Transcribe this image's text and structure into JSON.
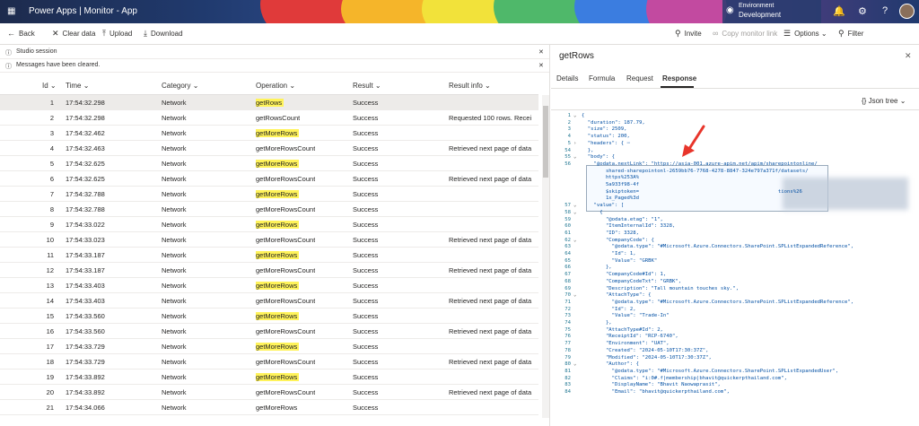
{
  "topbar": {
    "app_title": "Power Apps | Monitor - App",
    "env_label": "Environment",
    "env_value": "Development"
  },
  "toolbar": {
    "back": "Back",
    "clear": "Clear data",
    "upload": "Upload",
    "download": "Download",
    "invite": "Invite",
    "copy_link": "Copy monitor link",
    "options": "Options",
    "filter": "Filter"
  },
  "notices": {
    "studio": "Studio session",
    "cleared": "Messages have been cleared."
  },
  "table": {
    "columns": [
      "Id",
      "Time",
      "Category",
      "Operation",
      "Result",
      "Result info"
    ],
    "rows": [
      {
        "id": "1",
        "time": "17:54:32.298",
        "category": "Network",
        "operation": "getRows",
        "result": "Success",
        "info": "",
        "hl": true
      },
      {
        "id": "2",
        "time": "17:54:32.298",
        "category": "Network",
        "operation": "getRowsCount",
        "result": "Success",
        "info": "Requested 100 rows. Recei",
        "hl": false
      },
      {
        "id": "3",
        "time": "17:54:32.462",
        "category": "Network",
        "operation": "getMoreRows",
        "result": "Success",
        "info": "",
        "hl": true
      },
      {
        "id": "4",
        "time": "17:54:32.463",
        "category": "Network",
        "operation": "getMoreRowsCount",
        "result": "Success",
        "info": "Retrieved next page of data",
        "hl": false
      },
      {
        "id": "5",
        "time": "17:54:32.625",
        "category": "Network",
        "operation": "getMoreRows",
        "result": "Success",
        "info": "",
        "hl": true
      },
      {
        "id": "6",
        "time": "17:54:32.625",
        "category": "Network",
        "operation": "getMoreRowsCount",
        "result": "Success",
        "info": "Retrieved next page of data",
        "hl": false
      },
      {
        "id": "7",
        "time": "17:54:32.788",
        "category": "Network",
        "operation": "getMoreRows",
        "result": "Success",
        "info": "",
        "hl": true
      },
      {
        "id": "8",
        "time": "17:54:32.788",
        "category": "Network",
        "operation": "getMoreRowsCount",
        "result": "Success",
        "info": "",
        "hl": false
      },
      {
        "id": "9",
        "time": "17:54:33.022",
        "category": "Network",
        "operation": "getMoreRows",
        "result": "Success",
        "info": "",
        "hl": true
      },
      {
        "id": "10",
        "time": "17:54:33.023",
        "category": "Network",
        "operation": "getMoreRowsCount",
        "result": "Success",
        "info": "Retrieved next page of data",
        "hl": false
      },
      {
        "id": "11",
        "time": "17:54:33.187",
        "category": "Network",
        "operation": "getMoreRows",
        "result": "Success",
        "info": "",
        "hl": true
      },
      {
        "id": "12",
        "time": "17:54:33.187",
        "category": "Network",
        "operation": "getMoreRowsCount",
        "result": "Success",
        "info": "Retrieved next page of data",
        "hl": false
      },
      {
        "id": "13",
        "time": "17:54:33.403",
        "category": "Network",
        "operation": "getMoreRows",
        "result": "Success",
        "info": "",
        "hl": true
      },
      {
        "id": "14",
        "time": "17:54:33.403",
        "category": "Network",
        "operation": "getMoreRowsCount",
        "result": "Success",
        "info": "Retrieved next page of data",
        "hl": false
      },
      {
        "id": "15",
        "time": "17:54:33.560",
        "category": "Network",
        "operation": "getMoreRows",
        "result": "Success",
        "info": "",
        "hl": true
      },
      {
        "id": "16",
        "time": "17:54:33.560",
        "category": "Network",
        "operation": "getMoreRowsCount",
        "result": "Success",
        "info": "Retrieved next page of data",
        "hl": false
      },
      {
        "id": "17",
        "time": "17:54:33.729",
        "category": "Network",
        "operation": "getMoreRows",
        "result": "Success",
        "info": "",
        "hl": true
      },
      {
        "id": "18",
        "time": "17:54:33.729",
        "category": "Network",
        "operation": "getMoreRowsCount",
        "result": "Success",
        "info": "Retrieved next page of data",
        "hl": false
      },
      {
        "id": "19",
        "time": "17:54:33.892",
        "category": "Network",
        "operation": "getMoreRows",
        "result": "Success",
        "info": "",
        "hl": true
      },
      {
        "id": "20",
        "time": "17:54:33.892",
        "category": "Network",
        "operation": "getMoreRowsCount",
        "result": "Success",
        "info": "Retrieved next page of data",
        "hl": false
      },
      {
        "id": "21",
        "time": "17:54:34.066",
        "category": "Network",
        "operation": "getMoreRows",
        "result": "Success",
        "info": "",
        "hl": false
      }
    ]
  },
  "detail": {
    "title": "getRows",
    "tabs": [
      "Details",
      "Formula",
      "Request",
      "Response"
    ],
    "view_mode": "Json tree",
    "code_lines": [
      {
        "n": "1",
        "f": "⌄",
        "t": "{"
      },
      {
        "n": "2",
        "f": "",
        "t": "  \"duration\": 187.79,"
      },
      {
        "n": "3",
        "f": "",
        "t": "  \"size\": 2509,"
      },
      {
        "n": "4",
        "f": "",
        "t": "  \"status\": 200,"
      },
      {
        "n": "5",
        "f": "›",
        "t": "  \"headers\": { ⋯"
      },
      {
        "n": "54",
        "f": "",
        "t": "  },"
      },
      {
        "n": "55",
        "f": "⌄",
        "t": "  \"body\": {"
      },
      {
        "n": "56",
        "f": "",
        "t": "    \"@odata.nextLink\": \"https://asia-001.azure-apim.net/apim/sharepointonline/"
      },
      {
        "n": "",
        "f": "",
        "t": "        shared-sharepointonl-2659bb76-7768-4278-8847-324e797a371f/datasets/"
      },
      {
        "n": "",
        "f": "",
        "t": "        https%253A%"
      },
      {
        "n": "",
        "f": "",
        "t": "        5a933f98-4f"
      },
      {
        "n": "",
        "f": "",
        "t": "        $skiptoken=                                              tions%26"
      },
      {
        "n": "",
        "f": "",
        "t": "        1x_Paged%3d"
      },
      {
        "n": "57",
        "f": "⌄",
        "t": "    \"value\": ["
      },
      {
        "n": "58",
        "f": "⌄",
        "t": "      {"
      },
      {
        "n": "59",
        "f": "",
        "t": "        \"@odata.etag\": \"1\","
      },
      {
        "n": "60",
        "f": "",
        "t": "        \"ItemInternalId\": 3328,"
      },
      {
        "n": "61",
        "f": "",
        "t": "        \"ID\": 3328,"
      },
      {
        "n": "62",
        "f": "⌄",
        "t": "        \"CompanyCode\": {"
      },
      {
        "n": "63",
        "f": "",
        "t": "          \"@odata.type\": \"#Microsoft.Azure.Connectors.SharePoint.SPListExpandedReference\","
      },
      {
        "n": "64",
        "f": "",
        "t": "          \"Id\": 1,"
      },
      {
        "n": "65",
        "f": "",
        "t": "          \"Value\": \"GRBK\""
      },
      {
        "n": "66",
        "f": "",
        "t": "        },"
      },
      {
        "n": "67",
        "f": "",
        "t": "        \"CompanyCode#Id\": 1,"
      },
      {
        "n": "68",
        "f": "",
        "t": "        \"CompanyCodeTxt\": \"GRBK\","
      },
      {
        "n": "69",
        "f": "",
        "t": "        \"Description\": \"Tall mountain touches sky.\","
      },
      {
        "n": "70",
        "f": "⌄",
        "t": "        \"AttachType\": {"
      },
      {
        "n": "71",
        "f": "",
        "t": "          \"@odata.type\": \"#Microsoft.Azure.Connectors.SharePoint.SPListExpandedReference\","
      },
      {
        "n": "72",
        "f": "",
        "t": "          \"Id\": 2,"
      },
      {
        "n": "73",
        "f": "",
        "t": "          \"Value\": \"Trade-In\""
      },
      {
        "n": "74",
        "f": "",
        "t": "        },"
      },
      {
        "n": "75",
        "f": "",
        "t": "        \"AttachType#Id\": 2,"
      },
      {
        "n": "76",
        "f": "",
        "t": "        \"ReceiptId\": \"RCP-6740\","
      },
      {
        "n": "77",
        "f": "",
        "t": "        \"Environment\": \"UAT\","
      },
      {
        "n": "78",
        "f": "",
        "t": "        \"Created\": \"2024-05-10T17:30:37Z\","
      },
      {
        "n": "79",
        "f": "",
        "t": "        \"Modified\": \"2024-05-10T17:30:37Z\","
      },
      {
        "n": "80",
        "f": "⌄",
        "t": "        \"Author\": {"
      },
      {
        "n": "81",
        "f": "",
        "t": "          \"@odata.type\": \"#Microsoft.Azure.Connectors.SharePoint.SPListExpandedUser\","
      },
      {
        "n": "82",
        "f": "",
        "t": "          \"Claims\": \"i:0#.f|membership|bhavit@quickerpthailand.com\","
      },
      {
        "n": "83",
        "f": "",
        "t": "          \"DisplayName\": \"Bhavit Naowaprasit\","
      },
      {
        "n": "84",
        "f": "",
        "t": "          \"Email\": \"bhavit@quickerpthailand.com\","
      }
    ]
  }
}
